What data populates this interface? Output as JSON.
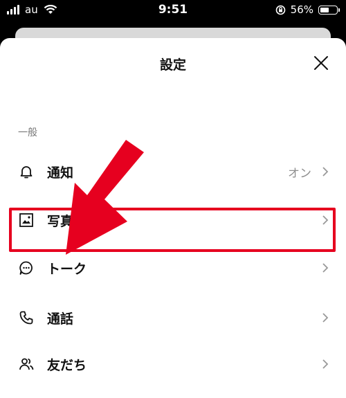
{
  "status_bar": {
    "carrier": "au",
    "time": "9:51",
    "battery_percent": "56%",
    "battery_level": 0.56
  },
  "sheet": {
    "title": "設定",
    "section_general": "一般"
  },
  "rows": [
    {
      "label": "通知",
      "value": "オン",
      "icon": "bell-icon"
    },
    {
      "label": "写真",
      "value": "",
      "icon": "photo-icon"
    },
    {
      "label": "トーク",
      "value": "",
      "icon": "chat-bubble-icon"
    },
    {
      "label": "通話",
      "value": "",
      "icon": "phone-icon"
    },
    {
      "label": "友だち",
      "value": "",
      "icon": "friends-icon"
    }
  ],
  "annotation": {
    "highlight_color": "#e6001f",
    "arrow_color": "#e6001f"
  }
}
